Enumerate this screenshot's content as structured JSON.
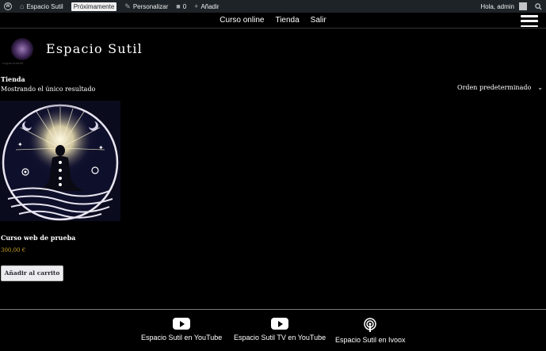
{
  "adminbar": {
    "site_name": "Espacio Sutil",
    "coming_soon_badge": "Próximamente",
    "customize_label": "Personalizar",
    "comments_count": "0",
    "new_label": "Añadir",
    "greeting": "Hola, admin"
  },
  "nav": {
    "items": [
      {
        "label": "Curso online"
      },
      {
        "label": "Tienda"
      },
      {
        "label": "Salir"
      }
    ]
  },
  "site": {
    "title": "Espacio Sutil",
    "logo_text": "espaciosutil"
  },
  "shop": {
    "breadcrumb": "Tienda",
    "result_count": "Mostrando el único resultado",
    "ordering_selected": "Orden predeterminado"
  },
  "product": {
    "title": "Curso web de prueba",
    "price": "300,00 €",
    "add_to_cart": "Añadir al carrito"
  },
  "footer": {
    "links": [
      {
        "label": "Espacio Sutil en YouTube",
        "icon": "youtube-icon"
      },
      {
        "label": "Espacio Sutil TV en YouTube",
        "icon": "youtube-icon"
      },
      {
        "label": "Espacio Sutil en Ivoox",
        "icon": "podcast-icon"
      }
    ]
  },
  "colors": {
    "background": "#000000",
    "adminbar": "#1d2327",
    "price": "#c9a227",
    "button": "#ececf0"
  }
}
